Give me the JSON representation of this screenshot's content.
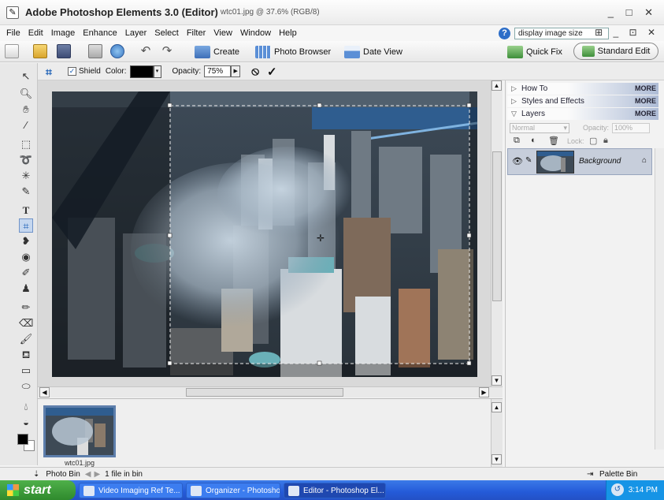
{
  "window": {
    "title": "Adobe Photoshop Elements 3.0 (Editor)",
    "doc_info": "wtc01.jpg @ 37.6% (RGB/8)",
    "controls": "_ □ ✕"
  },
  "menu": {
    "items": [
      "File",
      "Edit",
      "Image",
      "Enhance",
      "Layer",
      "Select",
      "Filter",
      "View",
      "Window",
      "Help"
    ],
    "help_search": "display image size",
    "controls": "⊞ _ ⊡ ✕"
  },
  "shortcuts": {
    "create": "Create",
    "photo_browser": "Photo Browser",
    "date_view": "Date View",
    "quick_fix": "Quick Fix",
    "standard_edit": "Standard Edit"
  },
  "options": {
    "shield_label": "Shield",
    "color_label": "Color:",
    "opacity_label": "Opacity:",
    "opacity_value": "75%"
  },
  "photo_bin": {
    "thumb_label": "wtc01.jpg",
    "title": "Photo Bin",
    "status": "1 file in bin",
    "palette_bin": "Palette Bin"
  },
  "palettes": {
    "how_to": "How To",
    "styles_effects": "Styles and Effects",
    "layers": "Layers",
    "more": "MORE",
    "blend_mode": "Normal",
    "opacity_label": "Opacity:",
    "opacity_value": "100%",
    "lock_label": "Lock:",
    "layer_name": "Background"
  },
  "taskbar": {
    "start": "start",
    "tasks": [
      "Video Imaging Ref Te...",
      "Organizer - Photosho...",
      "Editor - Photoshop El..."
    ],
    "clock": "3:14 PM"
  }
}
